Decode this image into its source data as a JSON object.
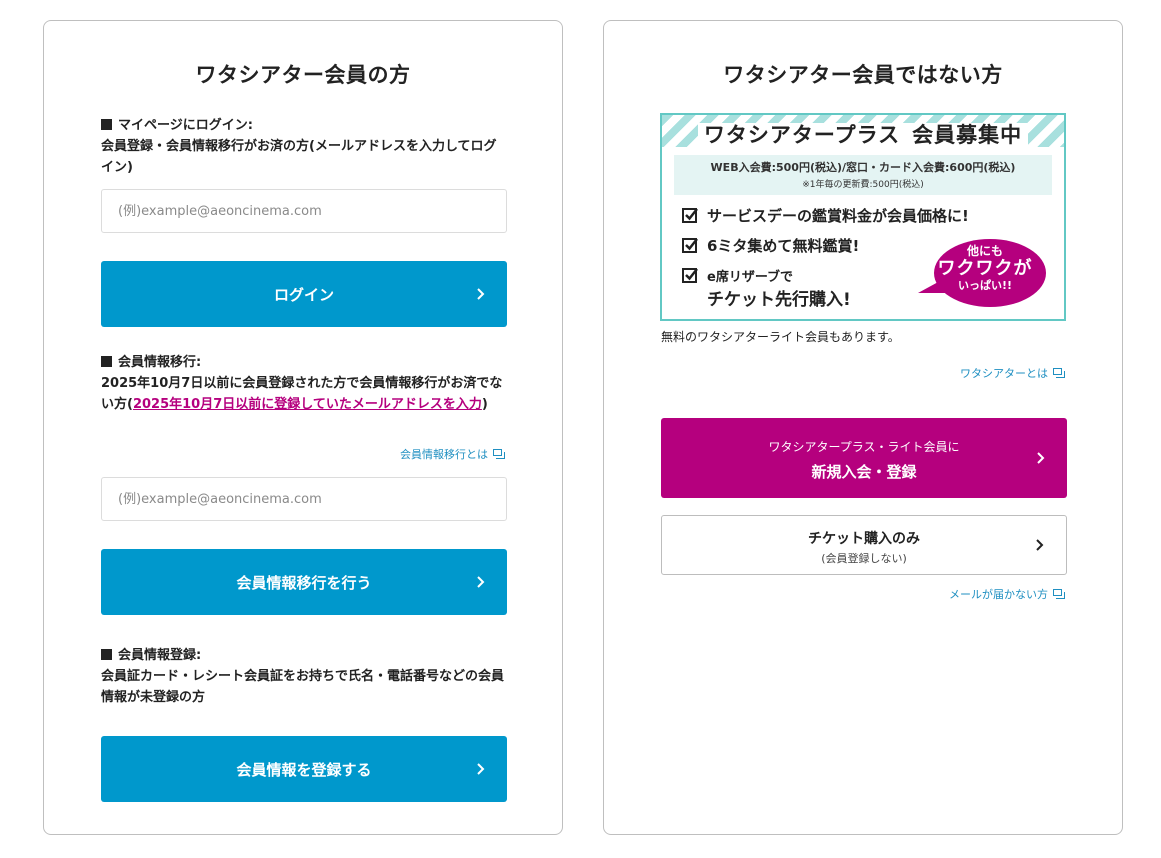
{
  "left": {
    "title": "ワタシアター会員の方",
    "login": {
      "heading": "マイページにログイン:",
      "desc": "会員登録・会員情報移行がお済の方(メールアドレスを入力してログイン)",
      "input_placeholder": "(例)example@aeoncinema.com",
      "button_label": "ログイン"
    },
    "migration": {
      "heading": "会員情報移行:",
      "desc_before": "2025年10月7日以前に会員登録された方で会員情報移行がお済でない方(",
      "desc_link": "2025年10月7日以前に登録していたメールアドレスを入力",
      "desc_after": ")",
      "about_link": "会員情報移行とは",
      "input_placeholder": "(例)example@aeoncinema.com",
      "button_label": "会員情報移行を行う"
    },
    "registration": {
      "heading": "会員情報登録:",
      "desc": "会員証カード・レシート会員証をお持ちで氏名・電話番号などの会員情報が未登録の方",
      "button_label": "会員情報を登録する"
    }
  },
  "right": {
    "title": "ワタシアター会員ではない方",
    "banner": {
      "title_part1": "ワタシアタープラス",
      "title_part2": "会員募集中",
      "fee_line": "WEB入会費:500円(税込)/窓口・カード入会費:600円(税込)",
      "renewal_line": "※1年毎の更新費:500円(税込)",
      "benefits": [
        "サービスデーの鑑賞料金が会員価格に!",
        "6ミタ集めて無料鑑賞!",
        "e席リザーブで",
        "チケット先行購入!"
      ],
      "bubble": [
        "他にも",
        "ワクワクが",
        "いっぱい!!"
      ]
    },
    "note": "無料のワタシアターライト会員もあります。",
    "about_link": "ワタシアターとは",
    "signup_button": {
      "line1": "ワタシアタープラス・ライト会員に",
      "line2": "新規入会・登録"
    },
    "ticket_button": {
      "line1": "チケット購入のみ",
      "line2": "(会員登録しない)"
    },
    "mail_link": "メールが届かない方"
  },
  "colors": {
    "primary_blue": "#0098cc",
    "magenta": "#b5007e",
    "link_blue": "#1f8fc1",
    "banner_teal": "#62c8c4"
  },
  "icons": [
    "chevron-right-icon",
    "external-window-icon",
    "checkbox-icon",
    "speech-bubble"
  ]
}
